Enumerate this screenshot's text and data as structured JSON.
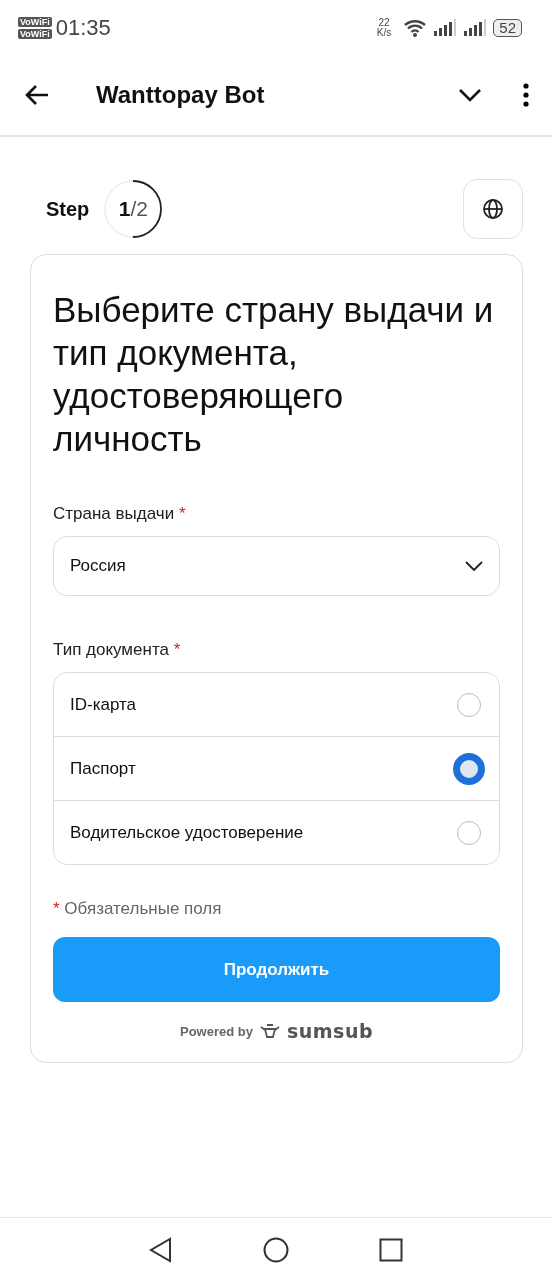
{
  "status_bar": {
    "sim_labels": [
      "VoWiFi",
      "VoWiFi"
    ],
    "time": "01:35",
    "net_speed": "22",
    "net_unit": "K/s",
    "battery": "52"
  },
  "app_bar": {
    "title": "Wanttopay Bot"
  },
  "step": {
    "label": "Step",
    "current": "1",
    "total": "/2"
  },
  "card": {
    "title": "Выберите страну выдачи и тип документа, удостоверяющего личность",
    "country": {
      "label": "Страна выдачи",
      "required_mark": "*",
      "value": "Россия"
    },
    "doc_type": {
      "label": "Тип документа",
      "required_mark": "*",
      "options": [
        {
          "label": "ID-карта",
          "selected": false
        },
        {
          "label": "Паспорт",
          "selected": true
        },
        {
          "label": "Водительское удостоверение",
          "selected": false
        }
      ]
    },
    "required_note": {
      "mark": "*",
      "text": "Обязательные поля"
    },
    "continue_button": "Продолжить",
    "powered_by": "Powered by",
    "brand": "sumsub"
  }
}
